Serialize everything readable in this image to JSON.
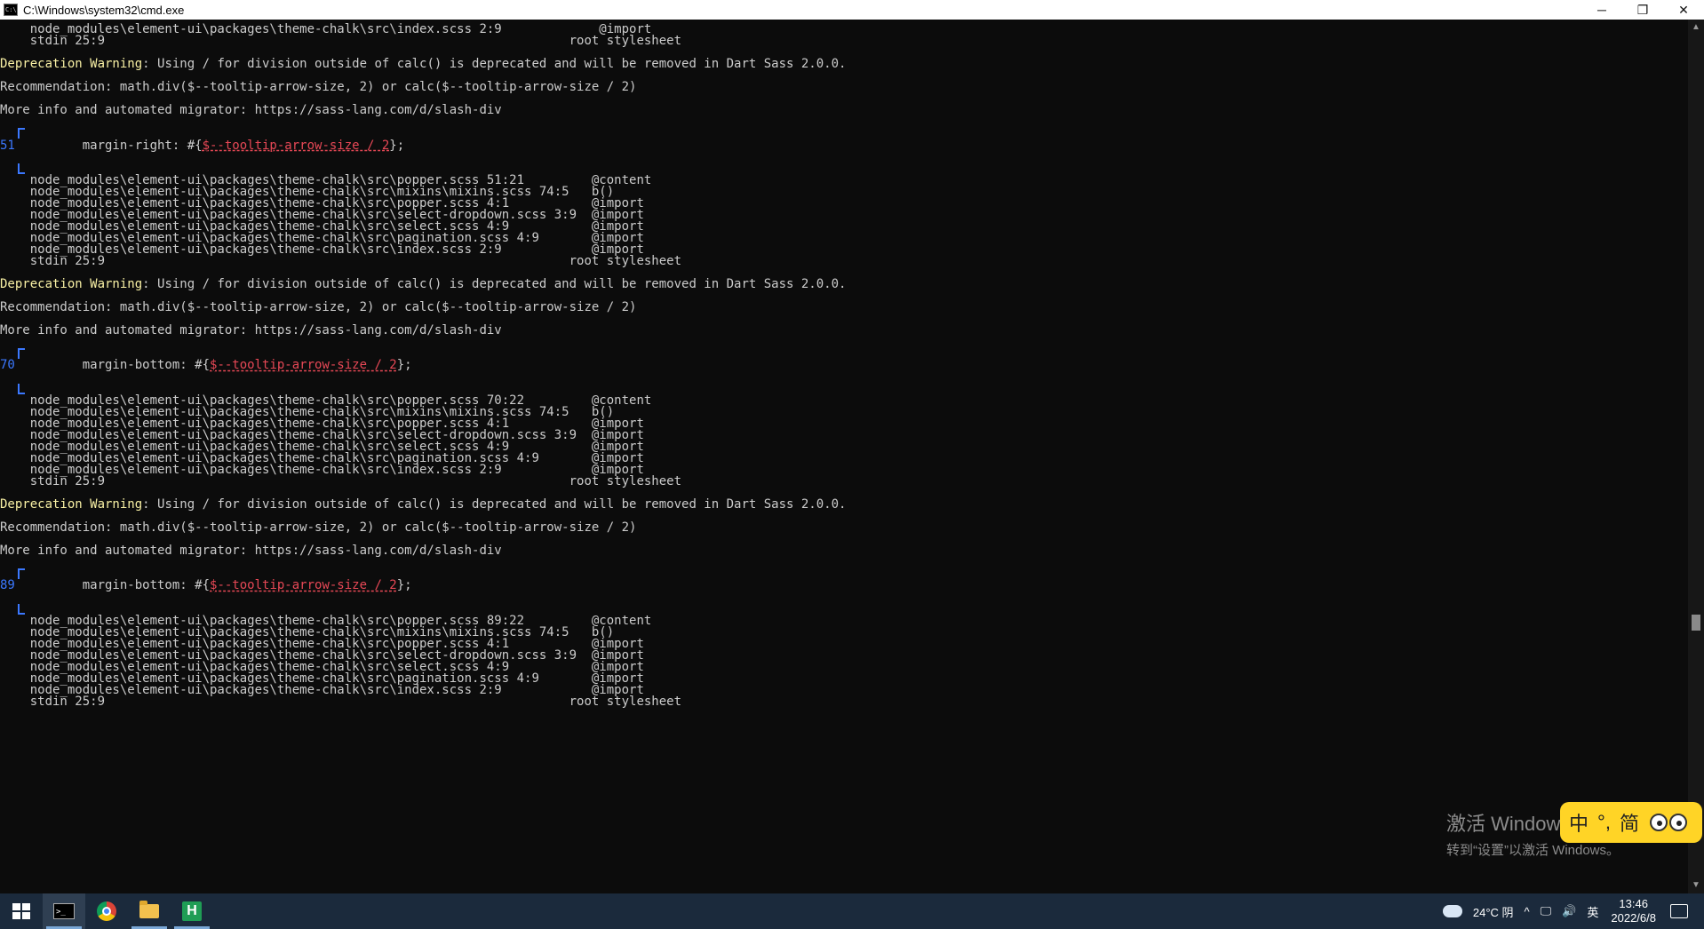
{
  "window": {
    "title": "C:\\Windows\\system32\\cmd.exe",
    "icon_label": "C:\\",
    "minimize_glyph": "─",
    "restore_glyph": "❐",
    "close_glyph": "✕"
  },
  "console": {
    "lines": [
      {
        "t": "    node_modules\\element-ui\\packages\\theme-chalk\\src\\index.scss 2:9             @import"
      },
      {
        "t": "    stdin 25:9                                                              root stylesheet"
      },
      {
        "t": ""
      },
      {
        "warn": "Deprecation Warning",
        "rest": ": Using / for division outside of calc() is deprecated and will be removed in Dart Sass 2.0.0."
      },
      {
        "t": ""
      },
      {
        "t": "Recommendation: math.div($--tooltip-arrow-size, 2) or calc($--tooltip-arrow-size / 2)"
      },
      {
        "t": ""
      },
      {
        "t": "More info and automated migrator: https://sass-lang.com/d/slash-div"
      },
      {
        "t": ""
      },
      {
        "bracket": "top"
      },
      {
        "num": "51",
        "pre": "         margin-right: #{",
        "err": "$--tooltip-arrow-size / 2",
        "post": "};"
      },
      {
        "bracket": "mid"
      },
      {
        "bracket": "bot"
      },
      {
        "t": "    node_modules\\element-ui\\packages\\theme-chalk\\src\\popper.scss 51:21         @content"
      },
      {
        "t": "    node_modules\\element-ui\\packages\\theme-chalk\\src\\mixins\\mixins.scss 74:5   b()"
      },
      {
        "t": "    node_modules\\element-ui\\packages\\theme-chalk\\src\\popper.scss 4:1           @import"
      },
      {
        "t": "    node_modules\\element-ui\\packages\\theme-chalk\\src\\select-dropdown.scss 3:9  @import"
      },
      {
        "t": "    node_modules\\element-ui\\packages\\theme-chalk\\src\\select.scss 4:9           @import"
      },
      {
        "t": "    node_modules\\element-ui\\packages\\theme-chalk\\src\\pagination.scss 4:9       @import"
      },
      {
        "t": "    node_modules\\element-ui\\packages\\theme-chalk\\src\\index.scss 2:9            @import"
      },
      {
        "t": "    stdin 25:9                                                              root stylesheet"
      },
      {
        "t": ""
      },
      {
        "warn": "Deprecation Warning",
        "rest": ": Using / for division outside of calc() is deprecated and will be removed in Dart Sass 2.0.0."
      },
      {
        "t": ""
      },
      {
        "t": "Recommendation: math.div($--tooltip-arrow-size, 2) or calc($--tooltip-arrow-size / 2)"
      },
      {
        "t": ""
      },
      {
        "t": "More info and automated migrator: https://sass-lang.com/d/slash-div"
      },
      {
        "t": ""
      },
      {
        "bracket": "top"
      },
      {
        "num": "70",
        "pre": "         margin-bottom: #{",
        "err": "$--tooltip-arrow-size / 2",
        "post": "};"
      },
      {
        "bracket": "mid"
      },
      {
        "bracket": "bot"
      },
      {
        "t": "    node_modules\\element-ui\\packages\\theme-chalk\\src\\popper.scss 70:22         @content"
      },
      {
        "t": "    node_modules\\element-ui\\packages\\theme-chalk\\src\\mixins\\mixins.scss 74:5   b()"
      },
      {
        "t": "    node_modules\\element-ui\\packages\\theme-chalk\\src\\popper.scss 4:1           @import"
      },
      {
        "t": "    node_modules\\element-ui\\packages\\theme-chalk\\src\\select-dropdown.scss 3:9  @import"
      },
      {
        "t": "    node_modules\\element-ui\\packages\\theme-chalk\\src\\select.scss 4:9           @import"
      },
      {
        "t": "    node_modules\\element-ui\\packages\\theme-chalk\\src\\pagination.scss 4:9       @import"
      },
      {
        "t": "    node_modules\\element-ui\\packages\\theme-chalk\\src\\index.scss 2:9            @import"
      },
      {
        "t": "    stdin 25:9                                                              root stylesheet"
      },
      {
        "t": ""
      },
      {
        "warn": "Deprecation Warning",
        "rest": ": Using / for division outside of calc() is deprecated and will be removed in Dart Sass 2.0.0."
      },
      {
        "t": ""
      },
      {
        "t": "Recommendation: math.div($--tooltip-arrow-size, 2) or calc($--tooltip-arrow-size / 2)"
      },
      {
        "t": ""
      },
      {
        "t": "More info and automated migrator: https://sass-lang.com/d/slash-div"
      },
      {
        "t": ""
      },
      {
        "bracket": "top"
      },
      {
        "num": "89",
        "pre": "         margin-bottom: #{",
        "err": "$--tooltip-arrow-size / 2",
        "post": "};"
      },
      {
        "bracket": "mid"
      },
      {
        "bracket": "bot"
      },
      {
        "t": "    node_modules\\element-ui\\packages\\theme-chalk\\src\\popper.scss 89:22         @content"
      },
      {
        "t": "    node_modules\\element-ui\\packages\\theme-chalk\\src\\mixins\\mixins.scss 74:5   b()"
      },
      {
        "t": "    node_modules\\element-ui\\packages\\theme-chalk\\src\\popper.scss 4:1           @import"
      },
      {
        "t": "    node_modules\\element-ui\\packages\\theme-chalk\\src\\select-dropdown.scss 3:9  @import"
      },
      {
        "t": "    node_modules\\element-ui\\packages\\theme-chalk\\src\\select.scss 4:9           @import"
      },
      {
        "t": "    node_modules\\element-ui\\packages\\theme-chalk\\src\\pagination.scss 4:9       @import"
      },
      {
        "t": "    node_modules\\element-ui\\packages\\theme-chalk\\src\\index.scss 2:9            @import"
      },
      {
        "t": "    stdin 25:9                                                              root stylesheet"
      }
    ]
  },
  "colors": {
    "warning": "#f9f1a5",
    "error": "#e74856",
    "line_number": "#3b78ff",
    "console_text": "#cccccc",
    "console_bg": "#0c0c0c"
  },
  "scrollbar": {
    "up_glyph": "▲",
    "down_glyph": "▼"
  },
  "watermark": {
    "line1": "激活 Windows",
    "line2": "转到“设置”以激活 Windows。"
  },
  "ime": {
    "lang": "中",
    "punct": "°,",
    "mode": "简"
  },
  "taskbar": {
    "apps": [
      {
        "name": "cmd",
        "icon": "terminal-icon",
        "label": ">_"
      },
      {
        "name": "chrome",
        "icon": "chrome-icon"
      },
      {
        "name": "explorer",
        "icon": "folder-icon"
      },
      {
        "name": "hbuilder",
        "icon": "hbuilder-icon",
        "label": "H"
      }
    ],
    "weather": "24°C 阴",
    "tray_chevron": "^",
    "network_glyph": "🖵",
    "volume_glyph": "🔊",
    "input_lang": "英",
    "time": "13:46",
    "date": "2022/6/8"
  }
}
